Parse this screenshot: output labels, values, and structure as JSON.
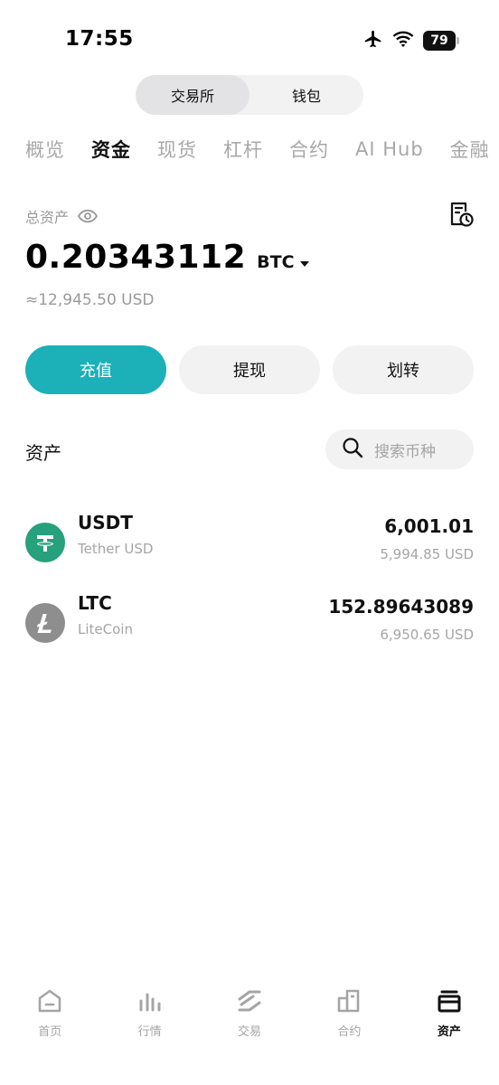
{
  "status_bar": {
    "time": "17:55",
    "battery": "79",
    "icons": [
      "airplane-icon",
      "wifi-icon",
      "battery-icon"
    ]
  },
  "segment": {
    "items": [
      {
        "label": "交易所",
        "active": true
      },
      {
        "label": "钱包",
        "active": false
      }
    ]
  },
  "tabs": [
    {
      "label": "概览",
      "active": false
    },
    {
      "label": "资金",
      "active": true
    },
    {
      "label": "现货",
      "active": false
    },
    {
      "label": "杠杆",
      "active": false
    },
    {
      "label": "合约",
      "active": false
    },
    {
      "label": "AI Hub",
      "active": false
    },
    {
      "label": "金融",
      "active": false
    }
  ],
  "total": {
    "label": "总资产",
    "btc_amount": "0.20343112",
    "btc_unit": "BTC",
    "usd_approx": "≈12,945.50 USD"
  },
  "actions": {
    "deposit": "充值",
    "withdraw": "提现",
    "transfer": "划转"
  },
  "assets": {
    "title": "资产",
    "search_placeholder": "搜索币种",
    "items": [
      {
        "symbol": "USDT",
        "name": "Tether USD",
        "amount": "6,001.01",
        "usd": "5,994.85 USD",
        "color": "#26a17b"
      },
      {
        "symbol": "LTC",
        "name": "LiteCoin",
        "amount": "152.89643089",
        "usd": "6,950.65 USD",
        "color": "#8e8e8e"
      }
    ]
  },
  "bottom_nav": [
    {
      "label": "首页",
      "icon": "home-icon",
      "active": false
    },
    {
      "label": "行情",
      "icon": "market-chart-icon",
      "active": false
    },
    {
      "label": "交易",
      "icon": "trade-icon",
      "active": false
    },
    {
      "label": "合约",
      "icon": "contract-icon",
      "active": false
    },
    {
      "label": "资产",
      "icon": "wallet-icon",
      "active": true
    }
  ],
  "colors": {
    "accent": "#1cb0b8",
    "usdt": "#26a17b",
    "ltc": "#8e8e8e"
  }
}
